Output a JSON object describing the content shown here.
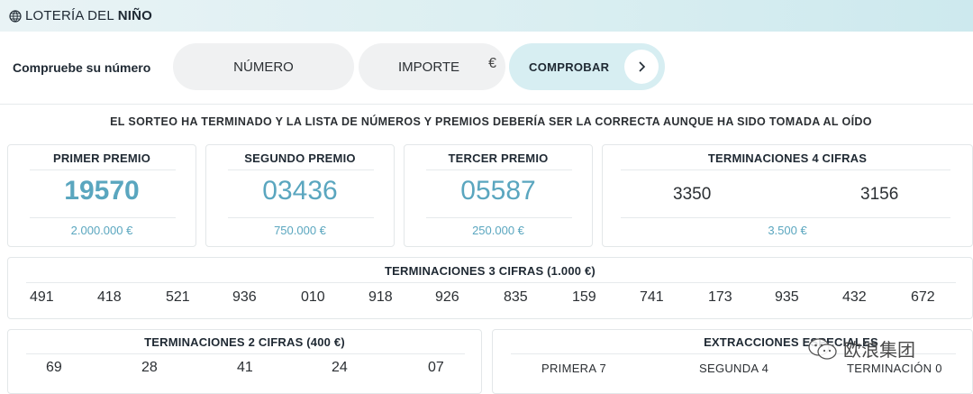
{
  "header": {
    "brand_prefix": "LOTERÍA DEL ",
    "brand_bold": "NIÑO"
  },
  "checker": {
    "label": "Compruebe su número",
    "numero_placeholder": "NÚMERO",
    "importe_placeholder": "IMPORTE",
    "currency": "€",
    "button_label": "COMPROBAR"
  },
  "notice": "EL SORTEO HA TERMINADO Y LA LISTA DE NÚMEROS Y PREMIOS DEBERÍA SER LA CORRECTA AUNQUE HA SIDO TOMADA AL OÍDO",
  "prizes": [
    {
      "title": "PRIMER PREMIO",
      "number": "19570",
      "amount": "2.000.000 €"
    },
    {
      "title": "SEGUNDO PREMIO",
      "number": "03436",
      "amount": "750.000 €"
    },
    {
      "title": "TERCER PREMIO",
      "number": "05587",
      "amount": "250.000 €"
    }
  ],
  "term4": {
    "title": "TERMINACIONES 4 CIFRAS",
    "numbers": [
      "3350",
      "3156"
    ],
    "amount": "3.500 €"
  },
  "term3": {
    "title": "TERMINACIONES 3 CIFRAS (1.000 €)",
    "numbers": [
      "491",
      "418",
      "521",
      "936",
      "010",
      "918",
      "926",
      "835",
      "159",
      "741",
      "173",
      "935",
      "432",
      "672"
    ]
  },
  "term2": {
    "title": "TERMINACIONES 2 CIFRAS (400 €)",
    "numbers": [
      "69",
      "28",
      "41",
      "24",
      "07"
    ]
  },
  "extracciones": {
    "title": "EXTRACCIONES ESPECIALES",
    "items": [
      "PRIMERA 7",
      "SEGUNDA 4",
      "TERMINACIÓN 0"
    ]
  },
  "watermark": {
    "text": "欧浪集团"
  },
  "colors": {
    "accent": "#5aa6bf",
    "button_bg": "#d7eef2",
    "pill_bg": "#f0f1f2",
    "header_bg": "#d9eef1"
  }
}
